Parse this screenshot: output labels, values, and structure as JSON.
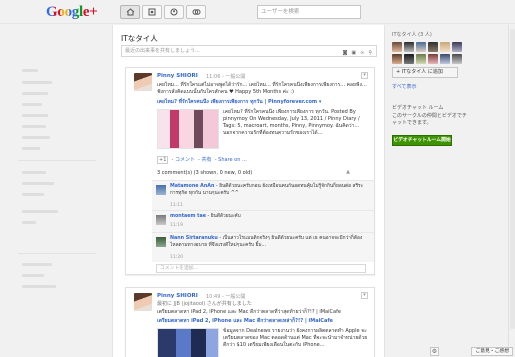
{
  "topbar": {
    "logo_google": "Google",
    "logo_plus": "+",
    "search_placeholder": "ユーザーを検索"
  },
  "stream": {
    "title": "ITなタイ人",
    "share_placeholder": "最近の出来事を共有しましょう..."
  },
  "posts": [
    {
      "author": "Pinny SHIORI",
      "time": "11:06",
      "visibility": "一般公開",
      "text": "เคยไหม... ที่รักใครแต่ไม่อาจพูดได้ว่ารัก... เคยไหม... ที่รักใครคนนึงเพียงการเพียงการ... คอยฟัง... ฟังการสั่งคิดแบบนั้นกับใครสักคน ♥ Happy 5th Months ค่ะ :)",
      "link_title": "เคยไหม? ที่รักใครคนนึง เพียงการเพียงการ ทุกวัน | Pinnyforever.com ▾",
      "link_text": "เคยไหม? ที่รักใครคนนึง เพียงการเพียงการ ทุกวัน. Posted By pinnymoy On Wednesday, July 13, 2011 / Pinny Diary / Tags: 5, macroart, months, Pinny, Pinnymoy. ฉันคิดว่า... นอกจากความรักที่ต้องทนความรักของเราได้...",
      "actions": [
        "+1",
        "コメント",
        "共有",
        "Share on ..."
      ],
      "comments_summary": "3 comment(s) (3 shown, 0 new, 0 old)",
      "comments": [
        {
          "name": "Matamone AnAn",
          "text": "ยินดีด้วยนะครับกอน ยังเหมือนคนกันอดทนคุ้มไม่รู้จักกินก็ยอนต่อ สรีระ การทุกิด ทุกกัน นานๆนะครับ ^^",
          "time": "11:11"
        },
        {
          "name": "montaem tae",
          "text": "ยินดีด้วยนะคับ",
          "time": "11:19"
        },
        {
          "name": "Nann Sirtaranuku",
          "text": "เป็นสาวโรแมนติกจริงๆ ยินดีด้วยนะครับ แต่ เธ คนอาจจะมีกว่าก็ต้องไหลตามทางอบาย ที่จึงแรงดีใหม่ๆนะครับ ยิ้ม...",
          "time": "11:20"
        }
      ],
      "add_comment": "コメントを追加..."
    },
    {
      "author": "Pinny SHIORI",
      "time": "10:49",
      "visibility": "一般公開",
      "reshare": "最初に JJB (jojitaool) さんが共有しました",
      "text": "เตรียมตลาดหา iPad 2, iPhone และ Mac ดีกว่าตลาดที่ว่าสุดท้ายว่าก็?!? | iMaiCafe",
      "link_title": "เตรียมตลาดหา iPad 2, iPhone และ Mac ดีกว่าตลาดเหล่าก็?!? | iMaiCafe",
      "link_text": "ข้อมูลจาก Dealnews รายงานว่า ยังคงการผลิตตลาดทำ Apple จะเตรียมตลาดของ Mac ตลอดด้านแต่ Mac ที่จะจะนำมาจำหน่ายด้วยดีกว่า $10 เตรียมเพียงเดือนในตะกับ iPhone..."
    }
  ],
  "sidebar": {
    "circle_title": "ITなタイ人 (3 人)",
    "add_label": "+ ITなタイ人 に追加",
    "view_all": "すべて表示",
    "chat_title": "ビデオチャット ルーム",
    "chat_desc": "このサークルの仲間とビデオでチャットできます。",
    "chat_button": "ビデオチャットルーム開始"
  },
  "footer": {
    "feedback": "ご意見・ご感想"
  },
  "colors": {
    "link": "#3366cc",
    "chat_button": "#3d9400",
    "accent_red": "#dd4b39"
  }
}
